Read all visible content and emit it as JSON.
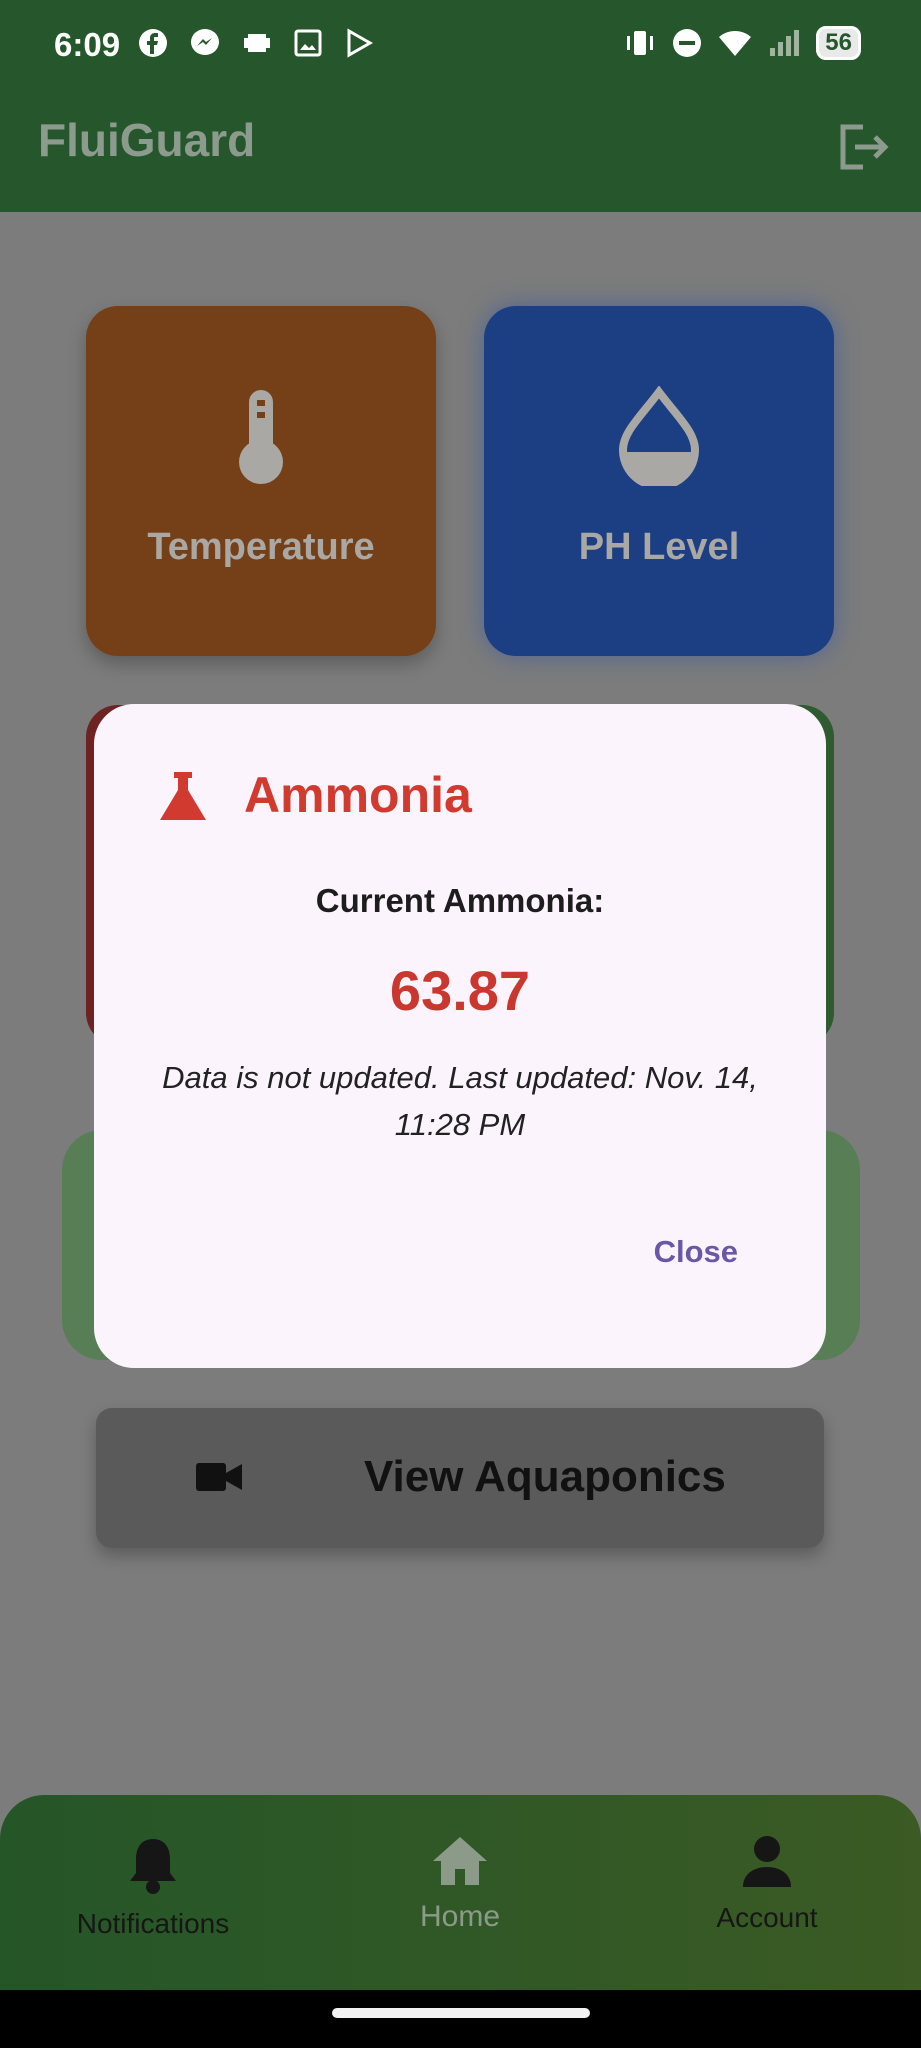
{
  "status_bar": {
    "time": "6:09",
    "battery": "56"
  },
  "app_bar": {
    "title": "FluiGuard"
  },
  "tiles": {
    "temperature": {
      "label": "Temperature",
      "color": "#754018"
    },
    "ph": {
      "label": "PH Level",
      "color": "#1b3f82"
    }
  },
  "view_button": {
    "label": "View Aquaponics"
  },
  "dialog": {
    "title": "Ammonia",
    "subtitle": "Current Ammonia:",
    "value": "63.87",
    "note": "Data is not updated. Last updated: Nov. 14, 11:28 PM",
    "close_label": "Close",
    "accent": "#d13a2f"
  },
  "bottom_nav": {
    "items": [
      {
        "label": "Notifications",
        "icon": "bell-icon"
      },
      {
        "label": "Home",
        "icon": "home-icon"
      },
      {
        "label": "Account",
        "icon": "person-icon"
      }
    ]
  }
}
